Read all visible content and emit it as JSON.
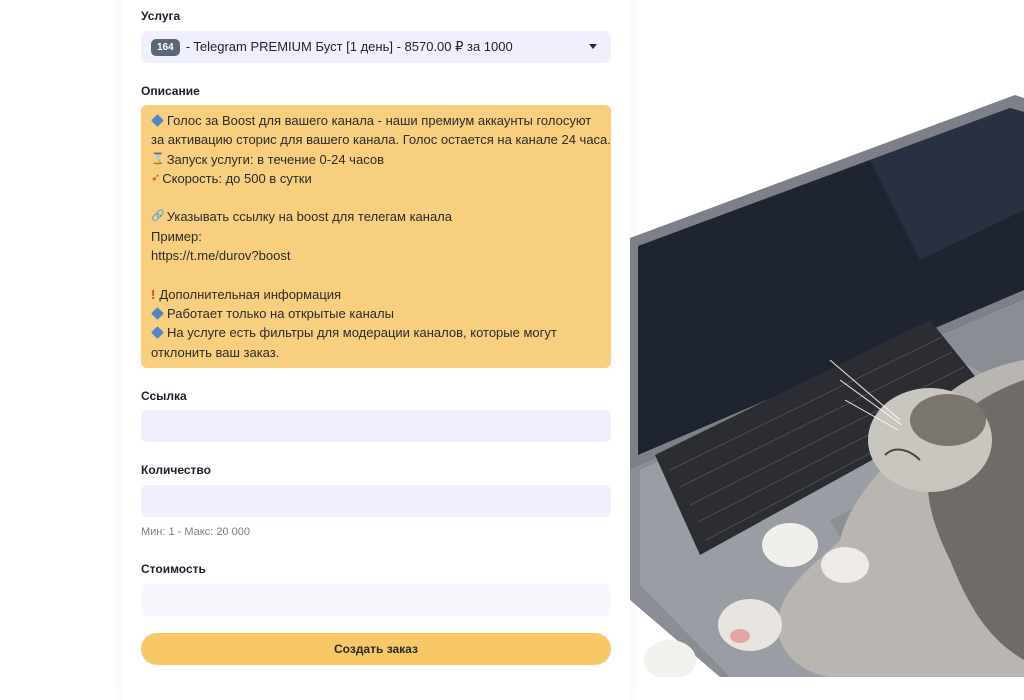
{
  "service": {
    "label": "Услуга",
    "badge": "164",
    "selected": "- Telegram PREMIUM Буст [1 день] - 8570.00 ₽ за 1000"
  },
  "description": {
    "label": "Описание",
    "lines": [
      "Голос за Boost для вашего канала - наши премиум аккаунты голосуют",
      "за активацию сторис для вашего канала. Голос остается на канале 24 часа.",
      "Запуск услуги: в течение 0-24 часов",
      "Скорость: до 500 в сутки",
      "",
      "Указывать ссылку на boost для телегам канала",
      "Пример:",
      "https://t.me/durov?boost",
      "",
      "Дополнительная информация",
      "Работает только на открытые каналы",
      "На услуге есть фильтры для модерации каналов, которые могут",
      "отклонить ваш заказ."
    ]
  },
  "link": {
    "label": "Ссылка",
    "value": ""
  },
  "quantity": {
    "label": "Количество",
    "value": "",
    "hint": "Мин: 1 - Макс: 20 000"
  },
  "cost": {
    "label": "Стоимость",
    "value": ""
  },
  "submit": {
    "label": "Создать заказ"
  },
  "colors": {
    "accent": "#f7c865",
    "field": "#f0f0fc",
    "description_bg": "#f7cf7f",
    "badge": "#5b6779"
  },
  "icons": [
    "chevron-down-icon",
    "diamond-icon",
    "hourglass-icon",
    "rocket-icon",
    "link-icon",
    "exclamation-icon"
  ]
}
